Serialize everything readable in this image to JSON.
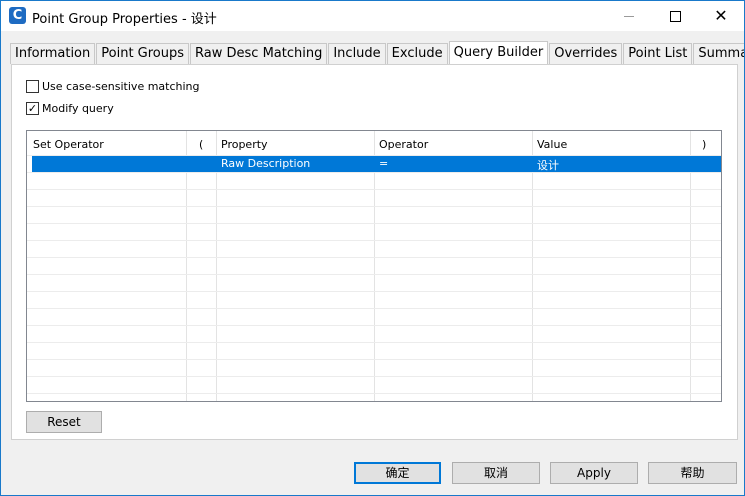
{
  "window": {
    "title": "Point Group Properties - 设计",
    "icon_glyph": "C"
  },
  "tabs": [
    {
      "label": "Information"
    },
    {
      "label": "Point Groups"
    },
    {
      "label": "Raw Desc Matching"
    },
    {
      "label": "Include"
    },
    {
      "label": "Exclude"
    },
    {
      "label": "Query Builder",
      "active": true
    },
    {
      "label": "Overrides"
    },
    {
      "label": "Point List"
    },
    {
      "label": "Summary"
    }
  ],
  "options": {
    "case_sensitive": {
      "label": "Use case-sensitive matching",
      "checked": false
    },
    "modify_query": {
      "label": "Modify query",
      "checked": true,
      "check_glyph": "✓"
    }
  },
  "grid": {
    "columns": [
      "Set Operator",
      "(",
      "Property",
      "Operator",
      "Value",
      ")"
    ],
    "rows": [
      {
        "set_operator": "",
        "open_paren": "",
        "property": "Raw Description",
        "operator": "=",
        "value": "设计",
        "close_paren": "",
        "selected": true
      }
    ],
    "selection_color": "#0078d7"
  },
  "buttons": {
    "reset": "Reset",
    "ok": "确定",
    "cancel": "取消",
    "apply": "Apply",
    "help": "帮助"
  },
  "colors": {
    "accent": "#0078d7",
    "app_icon": "#1e6bc2"
  }
}
